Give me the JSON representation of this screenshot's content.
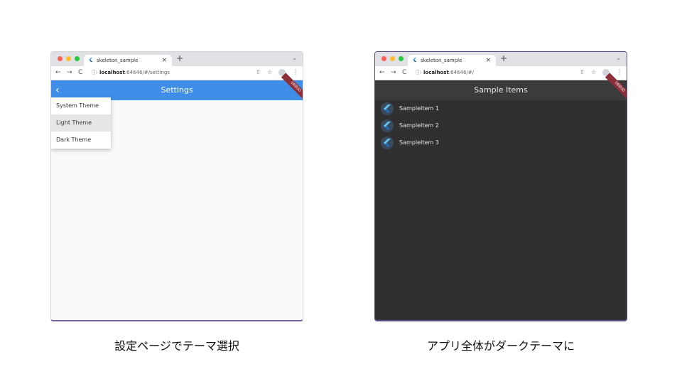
{
  "colors": {
    "red": "#ff5f57",
    "yellow": "#febc2e",
    "green": "#28c840",
    "blue_appbar": "#3f8fe8",
    "dark_appbar": "#3b3b3b",
    "dark_bg": "#303030"
  },
  "left": {
    "tab_title": "skeleton_sample",
    "url_host": "localhost",
    "url_path": ":64646/#/settings",
    "appbar_title": "Settings",
    "debug_banner": "DEBUG",
    "menu": [
      "System Theme",
      "Light Theme",
      "Dark Theme"
    ],
    "selected_index": 1,
    "caption": "設定ページでテーマ選択"
  },
  "right": {
    "tab_title": "skeleton_sample",
    "url_host": "localhost",
    "url_path": ":64646/#/",
    "appbar_title": "Sample Items",
    "debug_banner": "DEBUG",
    "items": [
      "SampleItem 1",
      "SampleItem 2",
      "SampleItem 3"
    ],
    "caption": "アプリ全体がダークテーマに"
  },
  "browser": {
    "new_tab": "+",
    "close": "×",
    "back": "←",
    "forward": "→",
    "reload": "C",
    "share_icon": "⇧",
    "star_icon": "☆",
    "menu_icon": "⋮",
    "chevron": "⌄"
  }
}
